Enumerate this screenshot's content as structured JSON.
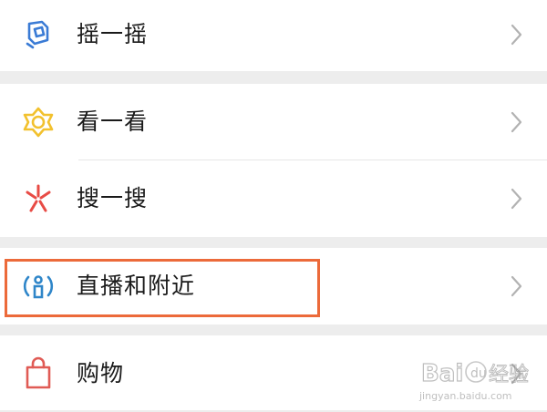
{
  "menu": {
    "shake": {
      "label": "摇一摇",
      "icon": "shake-icon"
    },
    "look": {
      "label": "看一看",
      "icon": "look-icon"
    },
    "search": {
      "label": "搜一搜",
      "icon": "search-icon"
    },
    "live_nearby": {
      "label": "直播和附近",
      "icon": "live-nearby-icon"
    },
    "shopping": {
      "label": "购物",
      "icon": "shopping-bag-icon"
    }
  },
  "colors": {
    "shake_icon": "#3a7bd5",
    "look_icon": "#f2c12e",
    "search_icon": "#e84b45",
    "live_icon": "#2f86c9",
    "shopping_icon": "#e05b55",
    "highlight": "#ec6a3a",
    "chevron": "#b2b2b2"
  },
  "watermark": {
    "text": "Baidu经验",
    "sub": "jingyan.baidu.com"
  }
}
